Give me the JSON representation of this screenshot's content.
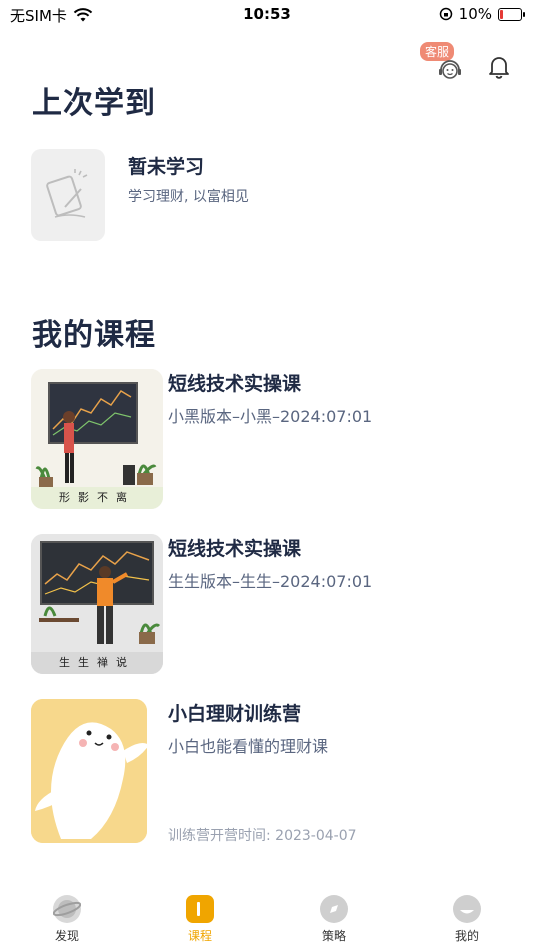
{
  "status": {
    "carrier": "无SIM卡",
    "time": "10:53",
    "battery": "10%"
  },
  "header": {
    "cs_badge": "客服"
  },
  "last_learned": {
    "section_title": "上次学到",
    "title": "暂未学习",
    "subtitle": "学习理财, 以富相见"
  },
  "my_courses": {
    "section_title": "我的课程",
    "items": [
      {
        "title": "短线技术实操课",
        "subtitle": "小黑版本–小黑–2024:07:01",
        "caption": "形影不离",
        "extra": ""
      },
      {
        "title": "短线技术实操课",
        "subtitle": "生生版本–生生–2024:07:01",
        "caption": "生生禅说",
        "extra": ""
      },
      {
        "title": "小白理财训练营",
        "subtitle": "小白也能看懂的理财课",
        "caption": "",
        "extra": "训练营开营时间: 2023-04-07"
      }
    ]
  },
  "tabs": [
    {
      "label": "发现",
      "icon": "planet-icon",
      "active": false
    },
    {
      "label": "课程",
      "icon": "course-icon",
      "active": true
    },
    {
      "label": "策略",
      "icon": "compass-icon",
      "active": false
    },
    {
      "label": "我的",
      "icon": "profile-icon",
      "active": false
    }
  ],
  "colors": {
    "accent": "#f0a500",
    "badge": "#ef8a74",
    "title": "#1f2a44"
  }
}
